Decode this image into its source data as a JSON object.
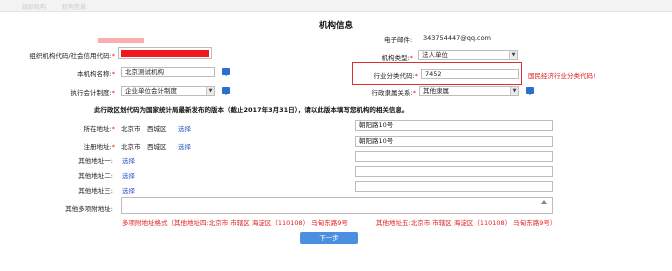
{
  "faded_nav": [
    "组织机构",
    "机构信息"
  ],
  "form_title": "机构信息",
  "email": {
    "label": "电子邮件:",
    "value": "343754447@qq.com"
  },
  "fields": {
    "org_code": {
      "label": "组织机构代码/社会信用代码:"
    },
    "org_name": {
      "label": "本机构名称:",
      "value": "北京测试机构"
    },
    "accounting_system": {
      "label": "执行会计制度:",
      "value": "企业单位会计制度"
    },
    "entity_type": {
      "label": "机构类型:",
      "value": "法人单位"
    },
    "industry_code": {
      "label": "行业分类代码:",
      "value": "7452"
    },
    "admin_relation": {
      "label": "行政隶属关系:",
      "value": "其他隶属"
    }
  },
  "industry_note": "国民经济行业分类代码!",
  "region_notice": "此行政区划代码为国家统计局最新发布的版本（截止2017年3月31日），请以此版本填写您机构的相关信息。",
  "addresses": {
    "location": {
      "label": "所在地址:",
      "city": "北京市",
      "district": "西城区",
      "select": "选择",
      "detail": "朝阳路10号"
    },
    "registered": {
      "label": "注册地址:",
      "city": "北京市",
      "district": "西城区",
      "select": "选择",
      "detail": "朝阳路10号"
    },
    "other1": {
      "label": "其他地址一:",
      "select": "选择"
    },
    "other2": {
      "label": "其他地址二:",
      "select": "选择"
    },
    "other3": {
      "label": "其他地址三:",
      "select": "选择"
    },
    "more": {
      "label": "其他多项附地址:"
    }
  },
  "format_hint_left": "多项附地址格式（其他地址四:北京市 市辖区 海淀区（110108） 马甸东路9号",
  "format_hint_right": "其他地址五:北京市 市辖区 海淀区（110108） 马甸东路9号）",
  "next_button": "下一步",
  "colors": {
    "required": "#e02020",
    "link": "#2f5fc4",
    "highlight_box": "#d93030",
    "button": "#4a8fe0"
  },
  "icons": [
    "help-chat-icon",
    "dropdown-arrow-icon"
  ]
}
